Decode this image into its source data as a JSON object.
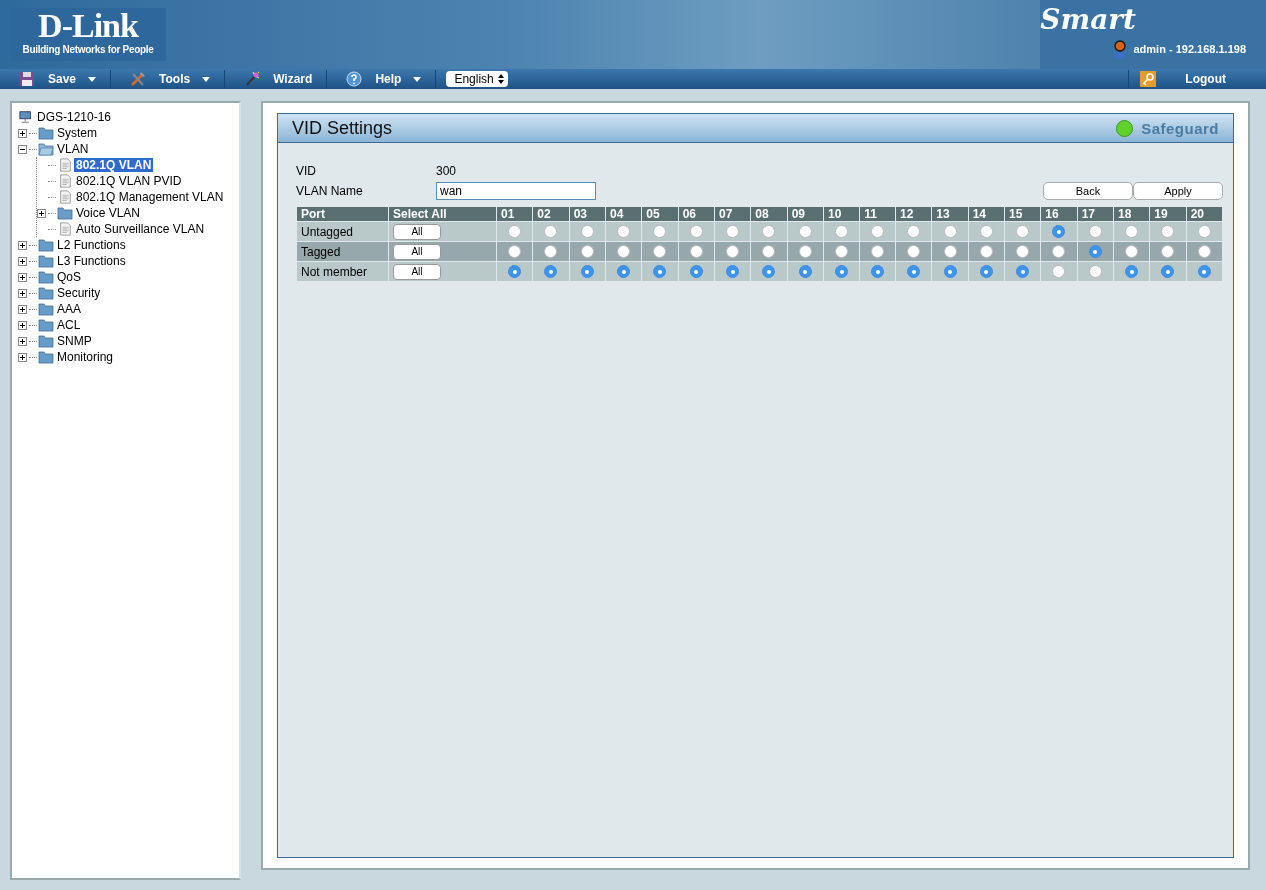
{
  "header": {
    "logo": "D-Link",
    "tagline": "Building Networks for People",
    "brand": "Smart",
    "user": "admin - 192.168.1.198"
  },
  "toolbar": {
    "menus": [
      {
        "label": "Save",
        "dropdown": true
      },
      {
        "label": "Tools",
        "dropdown": true
      },
      {
        "label": "Wizard",
        "dropdown": false
      },
      {
        "label": "Help",
        "dropdown": true
      }
    ],
    "language": "English",
    "logout": "Logout"
  },
  "tree": {
    "root": "DGS-1210-16",
    "items": [
      {
        "label": "System",
        "kind": "folder",
        "expanded": false,
        "selected": false
      },
      {
        "label": "VLAN",
        "kind": "folder",
        "expanded": true,
        "selected": false,
        "children": [
          {
            "label": "802.1Q VLAN",
            "kind": "page",
            "selected": true
          },
          {
            "label": "802.1Q VLAN PVID",
            "kind": "page",
            "selected": false
          },
          {
            "label": "802.1Q Management VLAN",
            "kind": "page",
            "selected": false
          },
          {
            "label": "Voice VLAN",
            "kind": "folder",
            "expanded": false,
            "selected": false
          },
          {
            "label": "Auto Surveillance VLAN",
            "kind": "page",
            "selected": false
          }
        ]
      },
      {
        "label": "L2 Functions",
        "kind": "folder",
        "expanded": false,
        "selected": false
      },
      {
        "label": "L3 Functions",
        "kind": "folder",
        "expanded": false,
        "selected": false
      },
      {
        "label": "QoS",
        "kind": "folder",
        "expanded": false,
        "selected": false
      },
      {
        "label": "Security",
        "kind": "folder",
        "expanded": false,
        "selected": false
      },
      {
        "label": "AAA",
        "kind": "folder",
        "expanded": false,
        "selected": false
      },
      {
        "label": "ACL",
        "kind": "folder",
        "expanded": false,
        "selected": false
      },
      {
        "label": "SNMP",
        "kind": "folder",
        "expanded": false,
        "selected": false
      },
      {
        "label": "Monitoring",
        "kind": "folder",
        "expanded": false,
        "selected": false
      }
    ]
  },
  "panel": {
    "title": "VID Settings",
    "safeguard": "Safeguard",
    "vid": {
      "label": "VID",
      "value": "300"
    },
    "vlan_name": {
      "label": "VLAN Name",
      "value": "wan"
    },
    "buttons": [
      "Back",
      "Apply"
    ],
    "table": {
      "columns": [
        "Port",
        "Select All"
      ],
      "ports": [
        "01",
        "02",
        "03",
        "04",
        "05",
        "06",
        "07",
        "08",
        "09",
        "10",
        "11",
        "12",
        "13",
        "14",
        "15",
        "16",
        "17",
        "18",
        "19",
        "20"
      ],
      "rows": [
        {
          "label": "Untagged",
          "button": "All",
          "cells": [
            false,
            false,
            false,
            false,
            false,
            false,
            false,
            false,
            false,
            false,
            false,
            false,
            false,
            false,
            false,
            true,
            false,
            false,
            false,
            false
          ]
        },
        {
          "label": "Tagged",
          "button": "All",
          "cells": [
            false,
            false,
            false,
            false,
            false,
            false,
            false,
            false,
            false,
            false,
            false,
            false,
            false,
            false,
            false,
            false,
            true,
            false,
            false,
            false
          ]
        },
        {
          "label": "Not member",
          "button": "All",
          "cells": [
            true,
            true,
            true,
            true,
            true,
            true,
            true,
            true,
            true,
            true,
            true,
            true,
            true,
            true,
            true,
            false,
            false,
            true,
            true,
            true
          ]
        }
      ]
    }
  }
}
